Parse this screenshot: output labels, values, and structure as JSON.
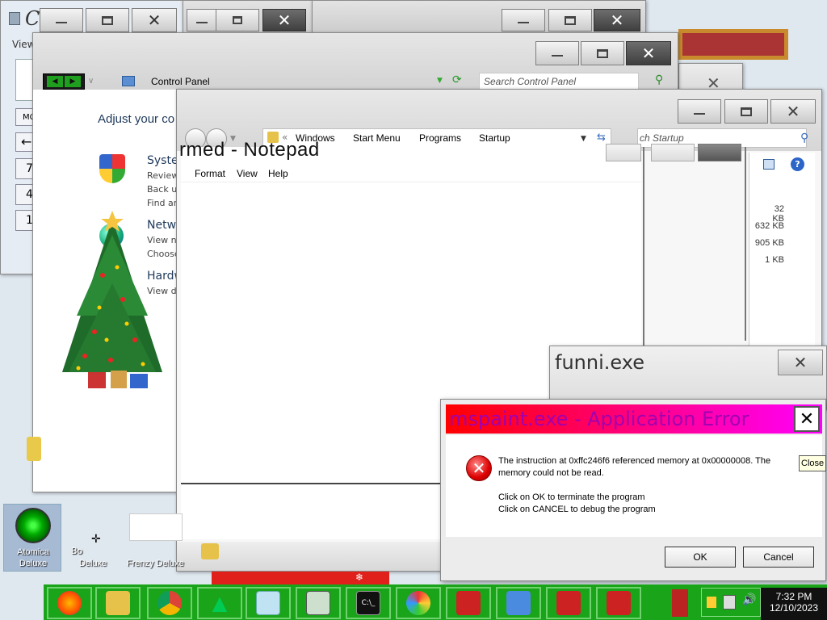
{
  "calculator": {
    "title_partial": "C",
    "menu_view": "View",
    "keys": [
      "MC",
      "←",
      "7",
      "4",
      "1"
    ]
  },
  "window2": {
    "min": "–",
    "max": "□",
    "close": "✕"
  },
  "window3": {
    "close": "✕"
  },
  "control_panel": {
    "address": "Control Panel",
    "search_placeholder": "Search Control Panel",
    "heading": "Adjust your co",
    "sections": [
      {
        "title": "Syste",
        "lines": [
          "Review",
          "Back up",
          "Find an"
        ]
      },
      {
        "title": "Netw",
        "lines": [
          "View n",
          "Choose"
        ]
      },
      {
        "title": "Hardw",
        "lines": [
          "View de"
        ]
      }
    ]
  },
  "explorer": {
    "breadcrumb": [
      "Windows",
      "Start Menu",
      "Programs",
      "Startup"
    ],
    "search_placeholder": "ch Startup",
    "sizes": [
      "32 KB",
      "632 KB",
      "905 KB",
      "1 KB"
    ]
  },
  "notepad": {
    "title_partial": "rmed - Notepad",
    "menu": [
      "Format",
      "View",
      "Help"
    ]
  },
  "funni": {
    "title": "funni.exe",
    "close": "✕"
  },
  "error_dialog": {
    "title": "mspaint.exe - Application Error",
    "message_line1": "The instruction at 0xffc246f6 referenced memory at 0x00000008. The",
    "message_line2": "memory could not be read.",
    "instruction1": "Click on OK to terminate the program",
    "instruction2": "Click on CANCEL to debug the program",
    "ok": "OK",
    "cancel": "Cancel",
    "close": "✕",
    "tooltip": "Close"
  },
  "desktop": {
    "icons": [
      "Atomica Deluxe",
      "Deluxe",
      "Frenzy Deluxe",
      "Bo"
    ]
  },
  "taskbar": {
    "time": "7:32 PM",
    "date": "12/10/2023",
    "icons": [
      "firefox-icon",
      "file-explorer-icon",
      "chrome-icon",
      "christmas-tree-icon",
      "notepad-icon",
      "calculator-icon",
      "cmd-icon",
      "paint-icon",
      "toolbox-icon",
      "control-panel-icon",
      "toolbox-icon",
      "toolbox-icon"
    ]
  },
  "colors": {
    "error_gradient_start": "#ff0000",
    "error_gradient_end": "#ff00ff",
    "taskbar_green": "#19a419"
  }
}
